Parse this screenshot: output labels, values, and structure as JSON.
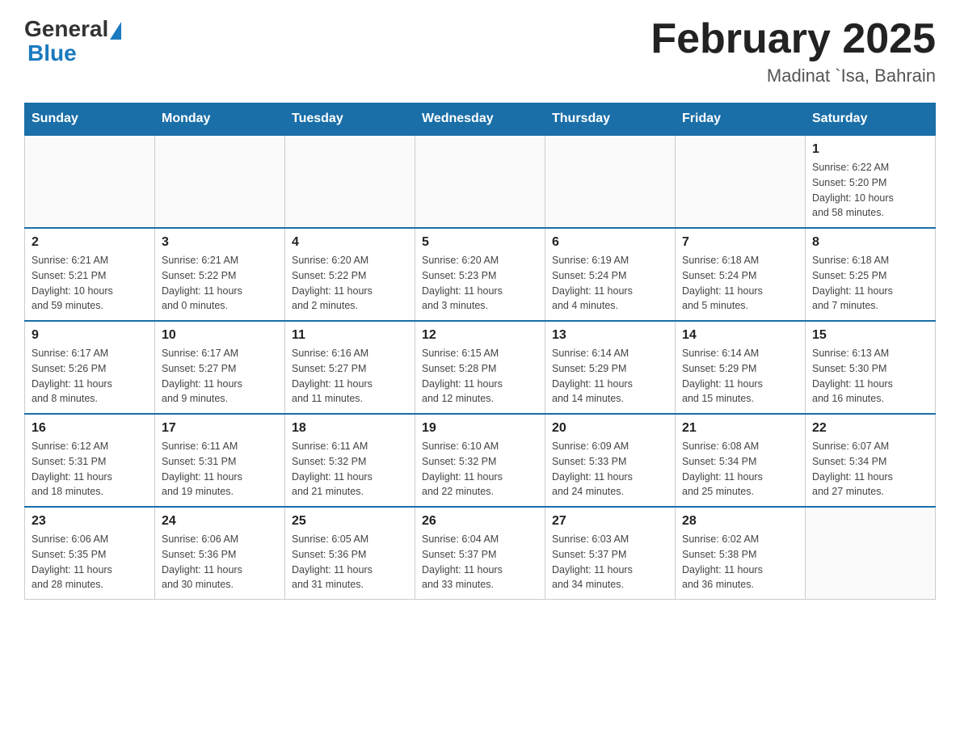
{
  "header": {
    "logo_general": "General",
    "logo_blue": "Blue",
    "month_title": "February 2025",
    "location": "Madinat `Isa, Bahrain"
  },
  "days_of_week": [
    "Sunday",
    "Monday",
    "Tuesday",
    "Wednesday",
    "Thursday",
    "Friday",
    "Saturday"
  ],
  "weeks": [
    [
      {
        "day": "",
        "info": ""
      },
      {
        "day": "",
        "info": ""
      },
      {
        "day": "",
        "info": ""
      },
      {
        "day": "",
        "info": ""
      },
      {
        "day": "",
        "info": ""
      },
      {
        "day": "",
        "info": ""
      },
      {
        "day": "1",
        "info": "Sunrise: 6:22 AM\nSunset: 5:20 PM\nDaylight: 10 hours\nand 58 minutes."
      }
    ],
    [
      {
        "day": "2",
        "info": "Sunrise: 6:21 AM\nSunset: 5:21 PM\nDaylight: 10 hours\nand 59 minutes."
      },
      {
        "day": "3",
        "info": "Sunrise: 6:21 AM\nSunset: 5:22 PM\nDaylight: 11 hours\nand 0 minutes."
      },
      {
        "day": "4",
        "info": "Sunrise: 6:20 AM\nSunset: 5:22 PM\nDaylight: 11 hours\nand 2 minutes."
      },
      {
        "day": "5",
        "info": "Sunrise: 6:20 AM\nSunset: 5:23 PM\nDaylight: 11 hours\nand 3 minutes."
      },
      {
        "day": "6",
        "info": "Sunrise: 6:19 AM\nSunset: 5:24 PM\nDaylight: 11 hours\nand 4 minutes."
      },
      {
        "day": "7",
        "info": "Sunrise: 6:18 AM\nSunset: 5:24 PM\nDaylight: 11 hours\nand 5 minutes."
      },
      {
        "day": "8",
        "info": "Sunrise: 6:18 AM\nSunset: 5:25 PM\nDaylight: 11 hours\nand 7 minutes."
      }
    ],
    [
      {
        "day": "9",
        "info": "Sunrise: 6:17 AM\nSunset: 5:26 PM\nDaylight: 11 hours\nand 8 minutes."
      },
      {
        "day": "10",
        "info": "Sunrise: 6:17 AM\nSunset: 5:27 PM\nDaylight: 11 hours\nand 9 minutes."
      },
      {
        "day": "11",
        "info": "Sunrise: 6:16 AM\nSunset: 5:27 PM\nDaylight: 11 hours\nand 11 minutes."
      },
      {
        "day": "12",
        "info": "Sunrise: 6:15 AM\nSunset: 5:28 PM\nDaylight: 11 hours\nand 12 minutes."
      },
      {
        "day": "13",
        "info": "Sunrise: 6:14 AM\nSunset: 5:29 PM\nDaylight: 11 hours\nand 14 minutes."
      },
      {
        "day": "14",
        "info": "Sunrise: 6:14 AM\nSunset: 5:29 PM\nDaylight: 11 hours\nand 15 minutes."
      },
      {
        "day": "15",
        "info": "Sunrise: 6:13 AM\nSunset: 5:30 PM\nDaylight: 11 hours\nand 16 minutes."
      }
    ],
    [
      {
        "day": "16",
        "info": "Sunrise: 6:12 AM\nSunset: 5:31 PM\nDaylight: 11 hours\nand 18 minutes."
      },
      {
        "day": "17",
        "info": "Sunrise: 6:11 AM\nSunset: 5:31 PM\nDaylight: 11 hours\nand 19 minutes."
      },
      {
        "day": "18",
        "info": "Sunrise: 6:11 AM\nSunset: 5:32 PM\nDaylight: 11 hours\nand 21 minutes."
      },
      {
        "day": "19",
        "info": "Sunrise: 6:10 AM\nSunset: 5:32 PM\nDaylight: 11 hours\nand 22 minutes."
      },
      {
        "day": "20",
        "info": "Sunrise: 6:09 AM\nSunset: 5:33 PM\nDaylight: 11 hours\nand 24 minutes."
      },
      {
        "day": "21",
        "info": "Sunrise: 6:08 AM\nSunset: 5:34 PM\nDaylight: 11 hours\nand 25 minutes."
      },
      {
        "day": "22",
        "info": "Sunrise: 6:07 AM\nSunset: 5:34 PM\nDaylight: 11 hours\nand 27 minutes."
      }
    ],
    [
      {
        "day": "23",
        "info": "Sunrise: 6:06 AM\nSunset: 5:35 PM\nDaylight: 11 hours\nand 28 minutes."
      },
      {
        "day": "24",
        "info": "Sunrise: 6:06 AM\nSunset: 5:36 PM\nDaylight: 11 hours\nand 30 minutes."
      },
      {
        "day": "25",
        "info": "Sunrise: 6:05 AM\nSunset: 5:36 PM\nDaylight: 11 hours\nand 31 minutes."
      },
      {
        "day": "26",
        "info": "Sunrise: 6:04 AM\nSunset: 5:37 PM\nDaylight: 11 hours\nand 33 minutes."
      },
      {
        "day": "27",
        "info": "Sunrise: 6:03 AM\nSunset: 5:37 PM\nDaylight: 11 hours\nand 34 minutes."
      },
      {
        "day": "28",
        "info": "Sunrise: 6:02 AM\nSunset: 5:38 PM\nDaylight: 11 hours\nand 36 minutes."
      },
      {
        "day": "",
        "info": ""
      }
    ]
  ]
}
